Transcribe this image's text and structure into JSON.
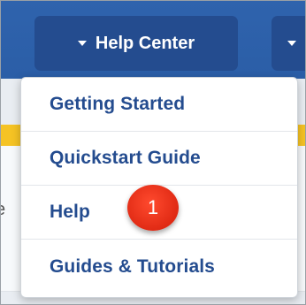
{
  "topbar": {
    "help_center_label": "Help Center"
  },
  "background": {
    "cut_text": "e"
  },
  "menu": {
    "items": [
      {
        "label": "Getting Started"
      },
      {
        "label": "Quickstart Guide"
      },
      {
        "label": "Help"
      },
      {
        "label": "Guides & Tutorials"
      }
    ]
  },
  "callout": {
    "number": "1",
    "color": "#e8341c"
  },
  "colors": {
    "nav_bg": "#2f63ad",
    "button_bg": "#244c8f",
    "menu_text": "#244c8f",
    "accent_yellow": "#f5c324"
  }
}
